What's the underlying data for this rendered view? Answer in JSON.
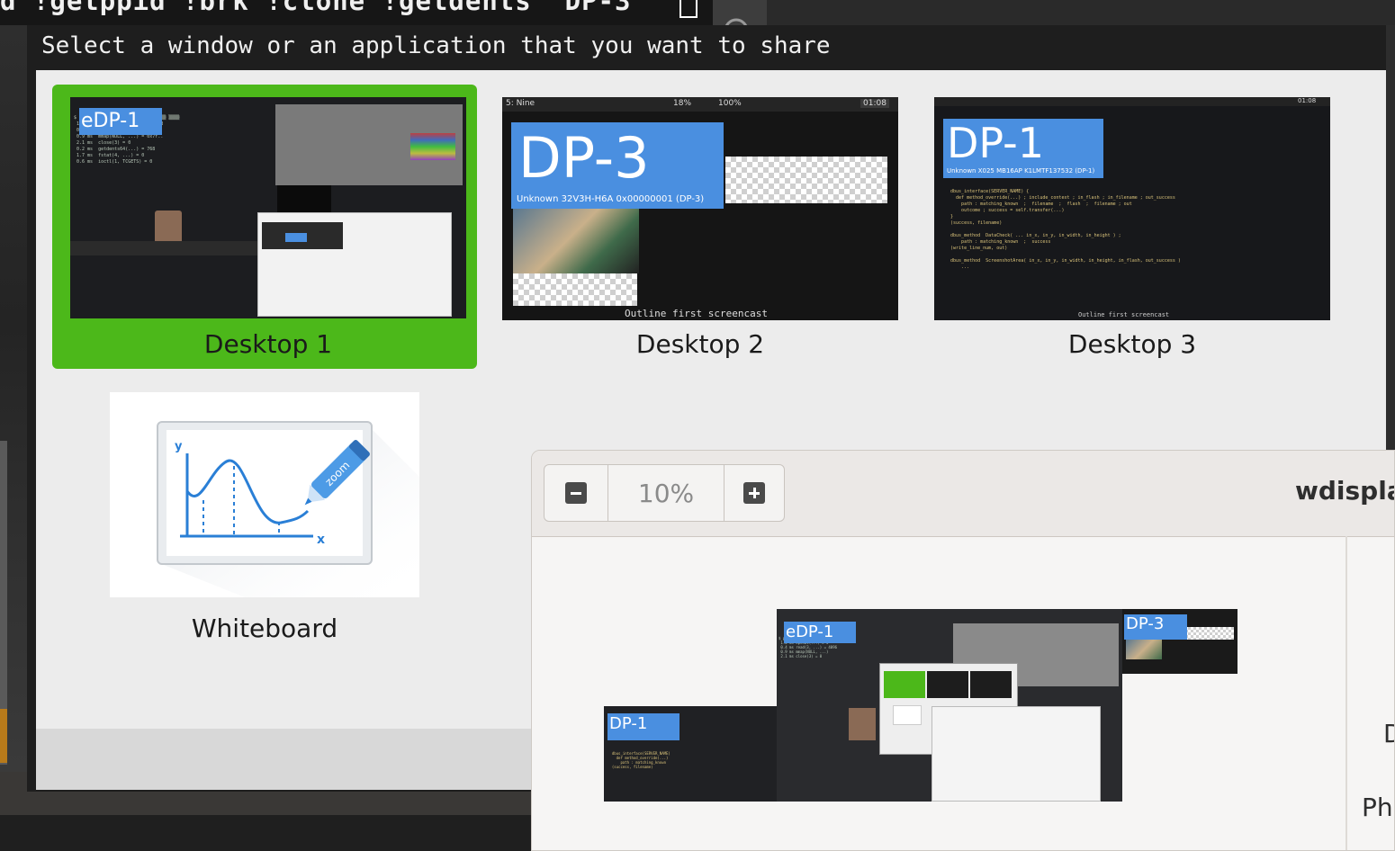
{
  "terminal": {
    "command_text": "d !getppid !brk !clone !getdents  DP-3"
  },
  "share_dialog": {
    "title": "Select a window or an application that you want to share",
    "tiles": [
      {
        "label": "Desktop 1",
        "badge": "eDP-1",
        "selected": true
      },
      {
        "label": "Desktop 2",
        "badge": "DP-3",
        "badge_sub": "Unknown 32V3H-H6A 0x00000001 (DP-3)",
        "caption": "Outline first screencast",
        "status_left": "5: Nine",
        "status_time": "01:08",
        "status_battery1": "18%",
        "status_battery2": "100%"
      },
      {
        "label": "Desktop 3",
        "badge": "DP-1",
        "badge_sub": "Unknown X025 MB16AP K1LMTF137532 (DP-1)",
        "caption": "Outline first screencast",
        "status_time": "01:08"
      },
      {
        "label": "Whiteboard",
        "icon_word": "zoom",
        "axis_x": "x",
        "axis_y": "y"
      }
    ]
  },
  "zoom_window": {
    "zoom_level": "10%",
    "title": "wdispla",
    "side_labels": [
      "D",
      "Ph"
    ],
    "monitors": [
      {
        "name": "eDP-1"
      },
      {
        "name": "DP-1"
      },
      {
        "name": "DP-3"
      }
    ]
  },
  "colors": {
    "selected_tile": "#4cb81a",
    "badge_blue": "#4a8fe0",
    "panel_bg": "#ececec",
    "dialog_bg": "#1e1e1e"
  }
}
